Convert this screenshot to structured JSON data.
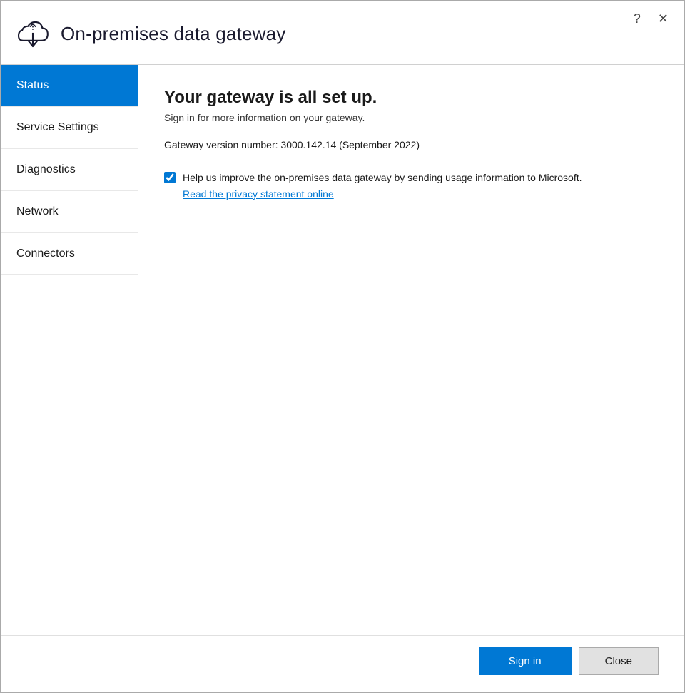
{
  "window": {
    "title": "On-premises data gateway",
    "icon_label": "cloud-gateway-icon"
  },
  "controls": {
    "help_label": "?",
    "close_label": "✕"
  },
  "sidebar": {
    "items": [
      {
        "id": "status",
        "label": "Status",
        "active": true
      },
      {
        "id": "service-settings",
        "label": "Service Settings",
        "active": false
      },
      {
        "id": "diagnostics",
        "label": "Diagnostics",
        "active": false
      },
      {
        "id": "network",
        "label": "Network",
        "active": false
      },
      {
        "id": "connectors",
        "label": "Connectors",
        "active": false
      }
    ]
  },
  "main": {
    "heading": "Your gateway is all set up.",
    "subheading": "Sign in for more information on your gateway.",
    "version_text": "Gateway version number: 3000.142.14 (September 2022)",
    "checkbox_label": "Help us improve the on-premises data gateway by sending usage information to Microsoft.",
    "checkbox_checked": true,
    "privacy_link_text": "Read the privacy statement online"
  },
  "footer": {
    "sign_in_label": "Sign in",
    "close_label": "Close"
  }
}
